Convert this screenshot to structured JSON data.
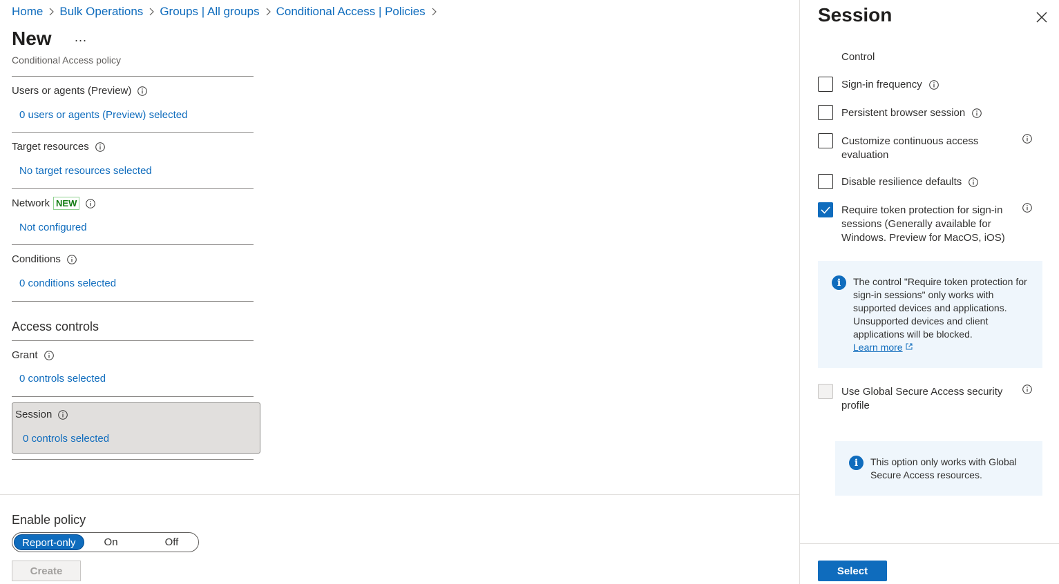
{
  "breadcrumb": {
    "items": [
      "Home",
      "Bulk Operations",
      "Groups | All groups",
      "Conditional Access | Policies"
    ]
  },
  "page": {
    "title": "New",
    "more": "...",
    "subtitle": "Conditional Access policy"
  },
  "sections": {
    "users": {
      "label": "Users or agents (Preview)",
      "value": "0 users or agents (Preview) selected"
    },
    "target": {
      "label": "Target resources",
      "value": "No target resources selected"
    },
    "network": {
      "label": "Network",
      "badge": "NEW",
      "value": "Not configured"
    },
    "conditions": {
      "label": "Conditions",
      "value": "0 conditions selected"
    }
  },
  "access_controls": {
    "title": "Access controls",
    "grant": {
      "label": "Grant",
      "value": "0 controls selected"
    },
    "session": {
      "label": "Session",
      "value": "0 controls selected"
    }
  },
  "enable_policy": {
    "label": "Enable policy",
    "options": [
      "Report-only",
      "On",
      "Off"
    ],
    "selected": "Report-only"
  },
  "create_label": "Create",
  "panel": {
    "title": "Session",
    "control_header": "Control",
    "options": [
      {
        "label": "Sign-in frequency",
        "checked": false
      },
      {
        "label": "Persistent browser session",
        "checked": false
      },
      {
        "label": "Customize continuous access evaluation",
        "checked": false
      },
      {
        "label": "Disable resilience defaults",
        "checked": false
      },
      {
        "label": "Require token protection for sign-in sessions (Generally available for Windows. Preview for MacOS, iOS)",
        "checked": true
      },
      {
        "label": "Use Global Secure Access security profile",
        "checked": false,
        "disabled": true
      }
    ],
    "token_info": {
      "text": "The control \"Require token protection for sign-in sessions\" only works with supported devices and applications. Unsupported devices and client applications will be blocked.",
      "link": "Learn more"
    },
    "gsa_info": {
      "text": "This option only works with Global Secure Access resources."
    },
    "select_label": "Select"
  },
  "colors": {
    "accent": "#0f6cbd",
    "info_bg": "#eff6fc",
    "badge_green": "#107c10"
  }
}
